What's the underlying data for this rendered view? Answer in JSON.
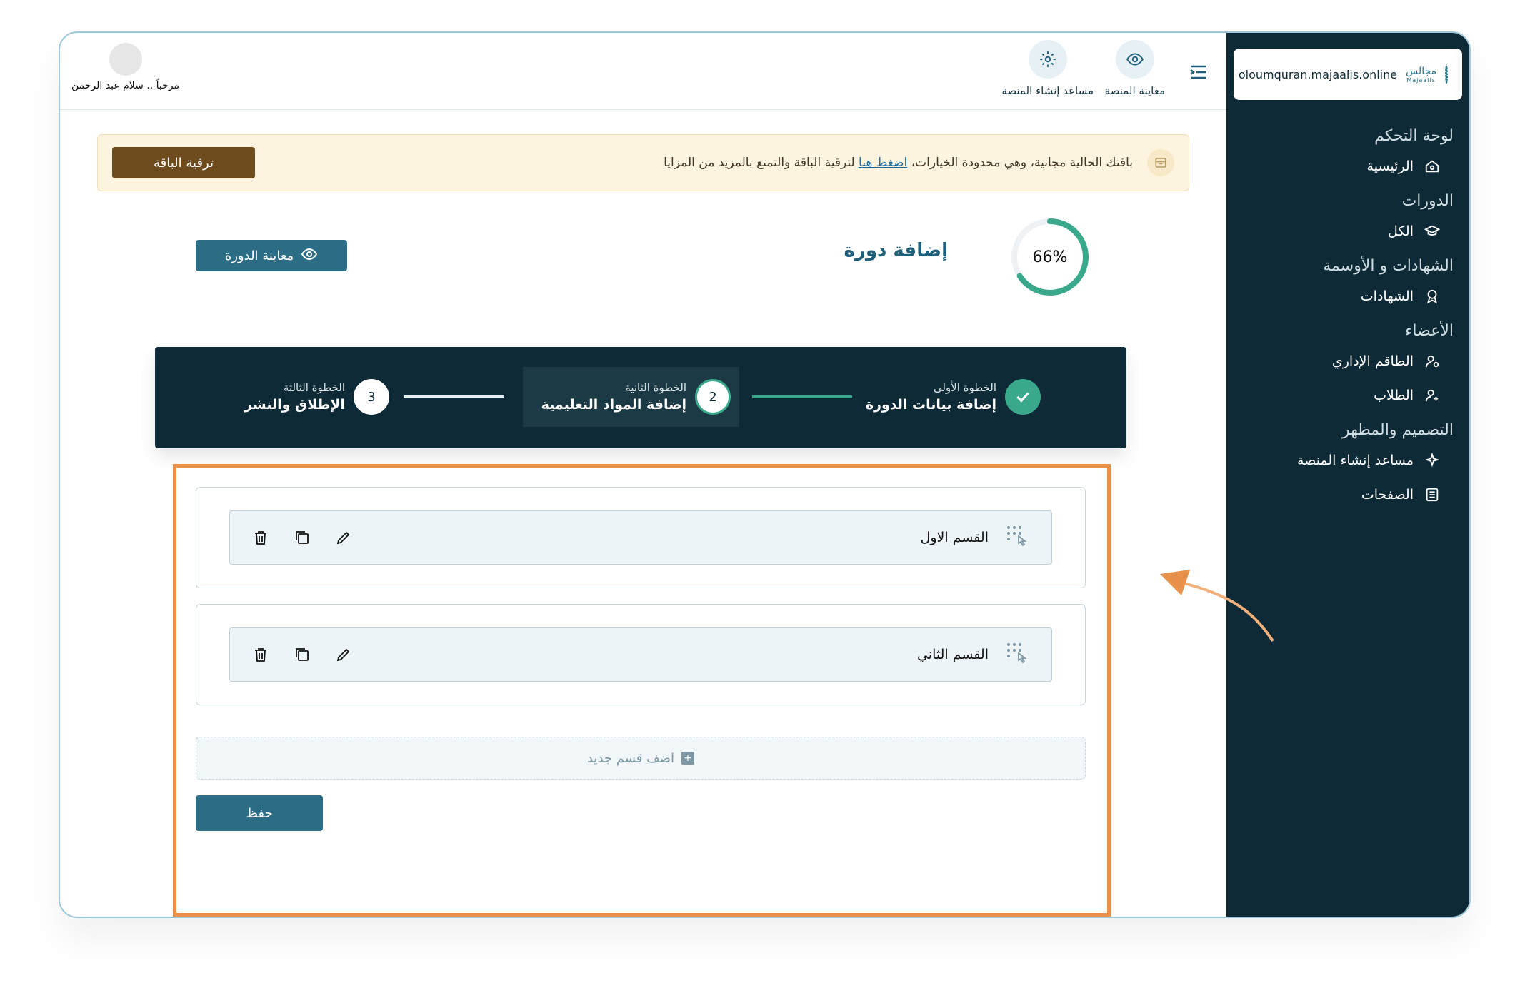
{
  "brand": {
    "url": "oloumquran.majaalis.online",
    "logo_ar": "مجالس",
    "logo_en": "Majaalis"
  },
  "sidebar": {
    "sections": [
      {
        "title": "لوحة التحكم",
        "items": [
          {
            "label": "الرئيسية",
            "icon": "home-icon"
          }
        ]
      },
      {
        "title": "الدورات",
        "items": [
          {
            "label": "الكل",
            "icon": "graduation-cap-icon"
          }
        ]
      },
      {
        "title": "الشهادات و الأوسمة",
        "items": [
          {
            "label": "الشهادات",
            "icon": "badge-icon"
          }
        ]
      },
      {
        "title": "الأعضاء",
        "items": [
          {
            "label": "الطاقم الإداري",
            "icon": "user-settings-icon"
          },
          {
            "label": "الطلاب",
            "icon": "user-add-icon"
          }
        ]
      },
      {
        "title": "التصميم والمظهر",
        "items": [
          {
            "label": "مساعد إنشاء المنصة",
            "icon": "sparkle-icon"
          },
          {
            "label": "الصفحات",
            "icon": "pages-icon"
          }
        ]
      }
    ]
  },
  "topbar": {
    "preview_label": "معاينة المنصة",
    "assistant_label": "مساعد إنشاء المنصة",
    "greeting": "مرحباً .. سلام عبد الرحمن"
  },
  "banner": {
    "text_before": "باقتك الحالية مجانية، وهي محدودة الخيارات،",
    "link": "اضغط هنا",
    "text_after": "لترقية الباقة والتمتع بالمزيد من المزايا",
    "button": "ترقية الباقة"
  },
  "course": {
    "title": "إضافة دورة",
    "progress_label": "66%",
    "progress": 0.66,
    "preview_button": "معاينة الدورة"
  },
  "steps": [
    {
      "small": "الخطوة الأولى",
      "big": "إضافة بيانات الدورة",
      "num": "",
      "status": "done"
    },
    {
      "small": "الخطوة الثانية",
      "big": "إضافة المواد التعليمية",
      "num": "2",
      "status": "active"
    },
    {
      "small": "الخطوة الثالثة",
      "big": "الإطلاق والنشر",
      "num": "3",
      "status": "pending"
    }
  ],
  "sections": [
    {
      "name": "القسم الاول"
    },
    {
      "name": "القسم الثاني"
    }
  ],
  "add_section_label": "اضف قسم جديد",
  "save_label": "حفظ",
  "colors": {
    "sidebar": "#0e2a36",
    "accent": "#2c6d86",
    "success": "#3aa88b",
    "highlight": "#e8914a",
    "upgrade": "#6d4b1c"
  }
}
